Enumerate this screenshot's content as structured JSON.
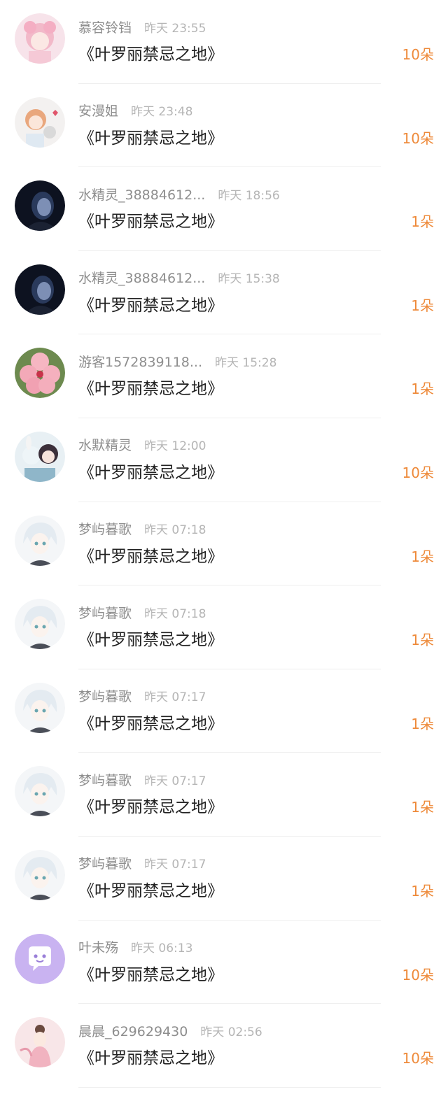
{
  "colors": {
    "count": "#ee8a3a",
    "name": "#8e8e8e",
    "time": "#b5b5b5",
    "title": "#222222",
    "divider": "#eeeeee"
  },
  "items": [
    {
      "name": "慕容铃铛",
      "time": "昨天 23:55",
      "title": "《叶罗丽禁忌之地》",
      "count": "10朵",
      "avatar": "pink-doll-avatar"
    },
    {
      "name": "安漫姐",
      "time": "昨天 23:48",
      "title": "《叶罗丽禁忌之地》",
      "count": "10朵",
      "avatar": "anime-girl-bunny-avatar"
    },
    {
      "name": "水精灵_38884612...",
      "time": "昨天 18:56",
      "title": "《叶罗丽禁忌之地》",
      "count": "1朵",
      "avatar": "dark-hooded-girl-avatar"
    },
    {
      "name": "水精灵_38884612...",
      "time": "昨天 15:38",
      "title": "《叶罗丽禁忌之地》",
      "count": "1朵",
      "avatar": "dark-hooded-girl-avatar"
    },
    {
      "name": "游客1572839118...",
      "time": "昨天 15:28",
      "title": "《叶罗丽禁忌之地》",
      "count": "1朵",
      "avatar": "pink-flower-avatar"
    },
    {
      "name": "水默精灵",
      "time": "昨天 12:00",
      "title": "《叶罗丽禁忌之地》",
      "count": "10朵",
      "avatar": "anime-pair-avatar"
    },
    {
      "name": "梦屿暮歌",
      "time": "昨天 07:18",
      "title": "《叶罗丽禁忌之地》",
      "count": "1朵",
      "avatar": "white-hair-boy-avatar"
    },
    {
      "name": "梦屿暮歌",
      "time": "昨天 07:18",
      "title": "《叶罗丽禁忌之地》",
      "count": "1朵",
      "avatar": "white-hair-boy-avatar"
    },
    {
      "name": "梦屿暮歌",
      "time": "昨天 07:17",
      "title": "《叶罗丽禁忌之地》",
      "count": "1朵",
      "avatar": "white-hair-boy-avatar"
    },
    {
      "name": "梦屿暮歌",
      "time": "昨天 07:17",
      "title": "《叶罗丽禁忌之地》",
      "count": "1朵",
      "avatar": "white-hair-boy-avatar"
    },
    {
      "name": "梦屿暮歌",
      "time": "昨天 07:17",
      "title": "《叶罗丽禁忌之地》",
      "count": "1朵",
      "avatar": "white-hair-boy-avatar"
    },
    {
      "name": "叶未殇",
      "time": "昨天 06:13",
      "title": "《叶罗丽禁忌之地》",
      "count": "10朵",
      "avatar": "purple-chat-bubble-avatar"
    },
    {
      "name": "晨晨_629629430",
      "time": "昨天 02:56",
      "title": "《叶罗丽禁忌之地》",
      "count": "10朵",
      "avatar": "pink-costume-girl-avatar"
    }
  ]
}
